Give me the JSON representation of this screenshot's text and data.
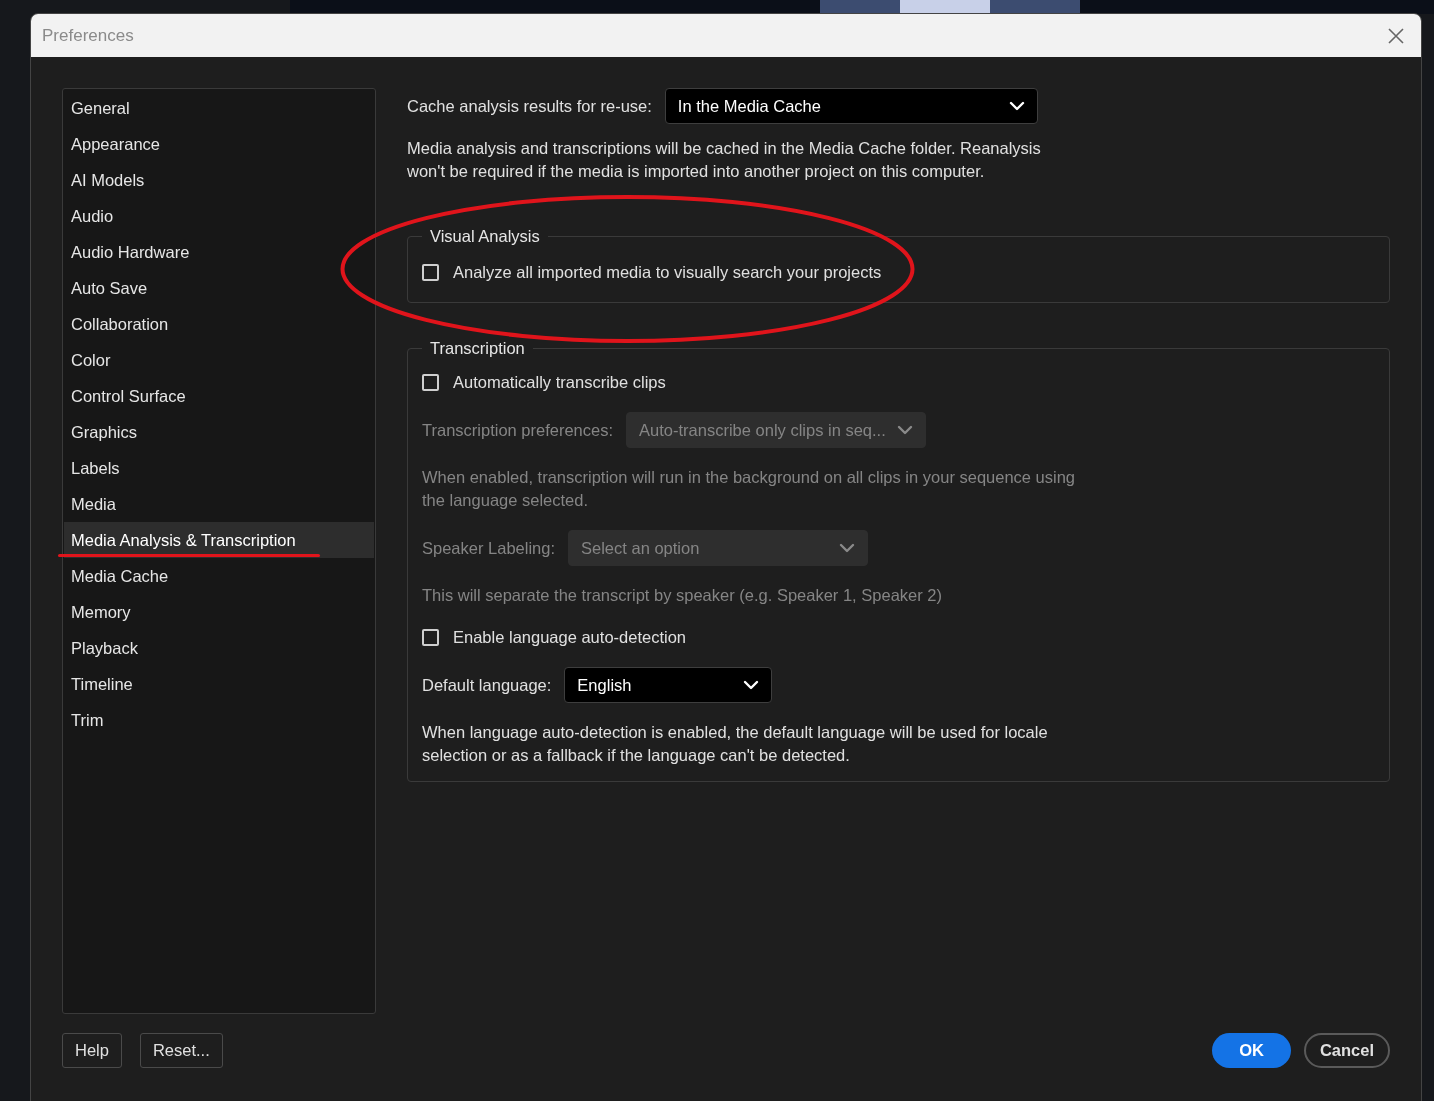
{
  "window": {
    "title": "Preferences"
  },
  "sidebar": {
    "items": [
      {
        "label": "General",
        "selected": false,
        "underlined": false
      },
      {
        "label": "Appearance",
        "selected": false,
        "underlined": false
      },
      {
        "label": "AI Models",
        "selected": false,
        "underlined": false
      },
      {
        "label": "Audio",
        "selected": false,
        "underlined": false
      },
      {
        "label": "Audio Hardware",
        "selected": false,
        "underlined": false
      },
      {
        "label": "Auto Save",
        "selected": false,
        "underlined": false
      },
      {
        "label": "Collaboration",
        "selected": false,
        "underlined": false
      },
      {
        "label": "Color",
        "selected": false,
        "underlined": false
      },
      {
        "label": "Control Surface",
        "selected": false,
        "underlined": false
      },
      {
        "label": "Graphics",
        "selected": false,
        "underlined": false
      },
      {
        "label": "Labels",
        "selected": false,
        "underlined": false
      },
      {
        "label": "Media",
        "selected": false,
        "underlined": false
      },
      {
        "label": "Media Analysis & Transcription",
        "selected": true,
        "underlined": true
      },
      {
        "label": "Media Cache",
        "selected": false,
        "underlined": false
      },
      {
        "label": "Memory",
        "selected": false,
        "underlined": false
      },
      {
        "label": "Playback",
        "selected": false,
        "underlined": false
      },
      {
        "label": "Timeline",
        "selected": false,
        "underlined": false
      },
      {
        "label": "Trim",
        "selected": false,
        "underlined": false
      }
    ]
  },
  "settings": {
    "cache": {
      "label": "Cache analysis results for re-use:",
      "value": "In the Media Cache"
    },
    "cache_note": "Media analysis and transcriptions will be cached in the Media Cache folder. Reanalysis won't be required if the media is imported into another project on this computer.",
    "sections": [
      {
        "title": "Visual Analysis",
        "circled": true,
        "items": [
          {
            "kind": "checkbox",
            "label": "Analyze all imported media to visually search your projects",
            "checked": false,
            "disabled": false
          }
        ]
      },
      {
        "title": "Transcription",
        "circled": false,
        "items": [
          {
            "kind": "checkbox",
            "label": "Automatically transcribe clips",
            "checked": false,
            "disabled": false
          },
          {
            "kind": "dropdown",
            "label": "Transcription preferences:",
            "value": "Auto-transcribe only clips in seq...",
            "disabled": true
          },
          {
            "kind": "note",
            "text": "When enabled, transcription will run in the background on all clips in your sequence using the language selected.",
            "disabled": true
          },
          {
            "kind": "dropdown",
            "label": "Speaker Labeling:",
            "value": "Select an option",
            "disabled": true
          },
          {
            "kind": "note",
            "text": "This will separate the transcript by speaker (e.g. Speaker 1, Speaker 2)",
            "disabled": true
          },
          {
            "kind": "checkbox",
            "label": "Enable language auto-detection",
            "checked": false,
            "disabled": false
          },
          {
            "kind": "dropdown",
            "label": "Default language:",
            "value": "English",
            "disabled": false
          },
          {
            "kind": "note",
            "text": "When language auto-detection is enabled, the default language will be used for locale selection or as a fallback if the language can't be detected.",
            "disabled": false
          }
        ]
      }
    ]
  },
  "buttons": [
    {
      "label": "Help",
      "kind": "secondary"
    },
    {
      "label": "Reset...",
      "kind": "secondary"
    },
    {
      "label": "OK",
      "kind": "primary"
    },
    {
      "label": "Cancel",
      "kind": "outline"
    }
  ]
}
